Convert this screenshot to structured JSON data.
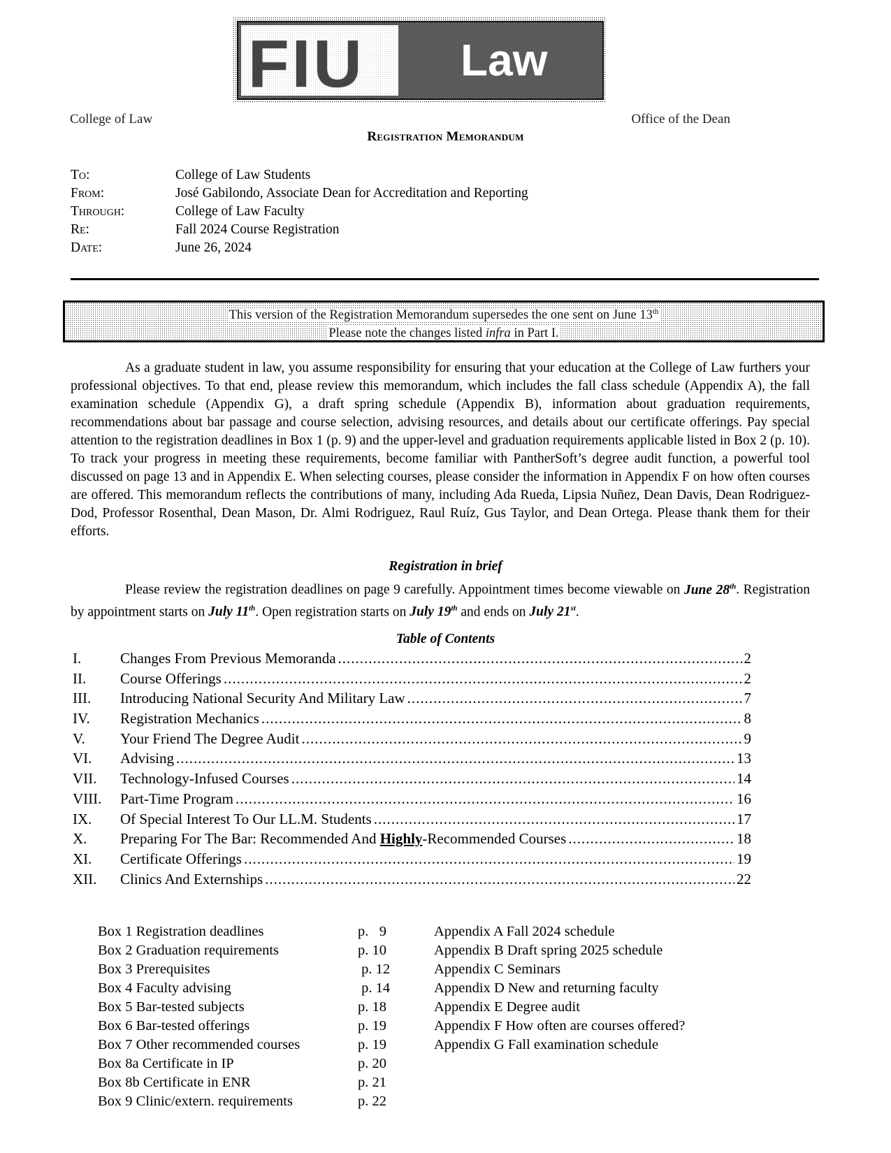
{
  "logo": {
    "left_text": "FIU",
    "right_text": "Law"
  },
  "header": {
    "left": "College of Law",
    "right": "Office of the Dean",
    "title": "Registration Memorandum"
  },
  "memo": [
    {
      "label": "To:",
      "value": "College of Law Students"
    },
    {
      "label": "From:",
      "value": "José Gabilondo, Associate Dean for Accreditation and Reporting"
    },
    {
      "label": "Through:",
      "value": "College of Law Faculty"
    },
    {
      "label": "Re:",
      "value": "Fall 2024 Course Registration"
    },
    {
      "label": "Date:",
      "value": "June 26, 2024"
    }
  ],
  "notice": {
    "line1": "This version of the Registration Memorandum supersedes the one sent on June 13",
    "line1_sup": "th",
    "line2_pre": "Please note the changes listed ",
    "line2_em": "infra",
    "line2_post": " in Part I."
  },
  "intro": "As a graduate student in law, you assume responsibility for ensuring that your education at the College of Law furthers your professional objectives. To that end, please review this memorandum, which includes the fall class schedule (Appendix A), the fall examination schedule (Appendix G), a draft spring schedule (Appendix B), information about graduation requirements, recommendations about bar passage and course selection, advising resources, and details about our certificate offerings. Pay special attention to the registration deadlines in Box 1 (p. 9) and the upper-level and graduation requirements applicable listed in Box 2 (p. 10). To track your progress in meeting these requirements, become familiar with PantherSoft’s degree audit function, a powerful tool discussed on page 13 and in Appendix E.  When selecting courses, please consider the information in Appendix F on how often courses are offered. This memorandum reflects the contributions of many, including Ada Rueda, Lipsia Nuñez, Dean Davis, Dean Rodriguez-Dod, Professor Rosenthal, Dean Mason, Dr. Almi Rodriguez, Raul Ruíz, Gus Taylor, and Dean Ortega.  Please thank them for their efforts.",
  "brief": {
    "heading": "Registration in brief",
    "t1": "Please review the registration deadlines on page 9 carefully. Appointment times become viewable on ",
    "d1": "June 28",
    "s1": "th",
    "t2": ". Registration by appointment starts on ",
    "d2": "July 11",
    "s2": "th",
    "t3": ". Open registration starts on ",
    "d3": "July 19",
    "s3": "th",
    "t4": " and ends on ",
    "d4": "July 21",
    "s4": "st",
    "t5": "."
  },
  "toc": {
    "heading": "Table of Contents",
    "items": [
      {
        "num": "I.",
        "title": "Changes From Previous Memoranda",
        "page": "2"
      },
      {
        "num": "II.",
        "title": "Course Offerings",
        "page": "2"
      },
      {
        "num": "III.",
        "title": "Introducing National Security And Military Law",
        "page": "7"
      },
      {
        "num": "IV.",
        "title": "Registration Mechanics",
        "page": "8"
      },
      {
        "num": "V.",
        "title": "Your Friend The Degree Audit",
        "page": "9"
      },
      {
        "num": "VI.",
        "title": "Advising",
        "page": "13"
      },
      {
        "num": "VII.",
        "title": "Technology-Infused Courses",
        "page": "14"
      },
      {
        "num": "VIII.",
        "title": "Part-Time Program",
        "page": "16"
      },
      {
        "num": "IX.",
        "title": "Of Special Interest To Our LL.M. Students",
        "page": "17"
      },
      {
        "num": "X.",
        "title_pre": "Preparing For The Bar: Recommended And ",
        "title_hl": "Highly",
        "title_post": "-Recommended Courses",
        "page": "18"
      },
      {
        "num": "XI.",
        "title": "Certificate Offerings",
        "page": "19"
      },
      {
        "num": "XII.",
        "title": "Clinics And Externships",
        "page": "22"
      }
    ]
  },
  "boxes": [
    {
      "label": "Box 1 Registration deadlines",
      "page": "p.   9"
    },
    {
      "label": "Box 2 Graduation requirements",
      "page": "p. 10"
    },
    {
      "label": "Box 3 Prerequisites",
      "page": " p. 12"
    },
    {
      "label": "Box 4 Faculty advising",
      "page": " p. 14"
    },
    {
      "label": "Box 5 Bar-tested subjects",
      "page": "p. 18"
    },
    {
      "label": "Box 6 Bar-tested offerings",
      "page": "p. 19"
    },
    {
      "label": "Box 7 Other recommended courses",
      "page": "p. 19"
    },
    {
      "label": "Box 8a Certificate in IP",
      "page": "p. 20"
    },
    {
      "label": "Box 8b Certificate in ENR",
      "page": "p. 21"
    },
    {
      "label": "Box 9 Clinic/extern. requirements",
      "page": "p. 22"
    }
  ],
  "appendices": [
    "Appendix A Fall 2024 schedule",
    "Appendix B Draft spring 2025 schedule",
    "Appendix C Seminars",
    "Appendix D New and returning faculty",
    "Appendix E Degree audit",
    "Appendix F How often are courses offered?",
    "Appendix G Fall examination schedule"
  ]
}
